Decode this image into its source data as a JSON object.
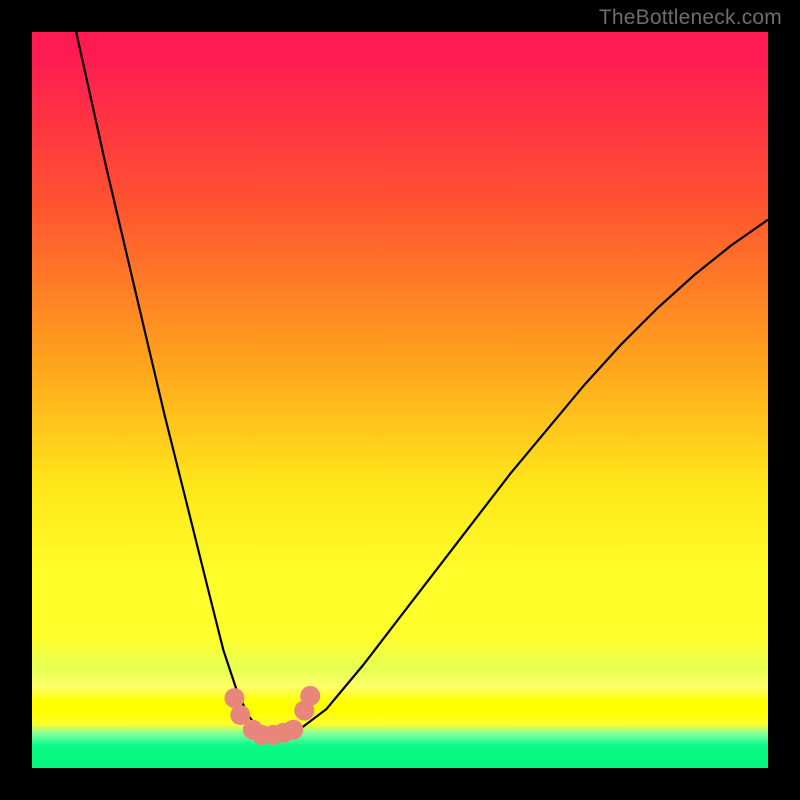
{
  "credit": "TheBottleneck.com",
  "chart_data": {
    "type": "line",
    "title": "",
    "xlabel": "",
    "ylabel": "",
    "xlim": [
      0,
      100
    ],
    "ylim": [
      0,
      100
    ],
    "series": [
      {
        "name": "bottleneck-curve",
        "x": [
          6,
          10,
          14,
          18,
          21,
          24,
          26,
          28,
          29.5,
          31,
          32.5,
          34,
          36,
          40,
          45,
          50,
          55,
          60,
          65,
          70,
          75,
          80,
          85,
          90,
          95,
          100
        ],
        "y": [
          100,
          82,
          65,
          48,
          36,
          24,
          16,
          10,
          7,
          5,
          4.5,
          4.5,
          5,
          8,
          14,
          20.5,
          27,
          33.5,
          40,
          46,
          52,
          57.5,
          62.5,
          67,
          71,
          74.5
        ]
      }
    ],
    "markers": [
      {
        "name": "left-cluster-top",
        "x": 27.5,
        "y": 9.5
      },
      {
        "name": "left-cluster-bot",
        "x": 28.3,
        "y": 7.2
      },
      {
        "name": "bottom-a",
        "x": 30.0,
        "y": 5.2
      },
      {
        "name": "bottom-b",
        "x": 31.2,
        "y": 4.5
      },
      {
        "name": "bottom-c",
        "x": 32.8,
        "y": 4.5
      },
      {
        "name": "bottom-d",
        "x": 34.2,
        "y": 4.8
      },
      {
        "name": "bottom-e",
        "x": 35.5,
        "y": 5.2
      },
      {
        "name": "right-cluster-bot",
        "x": 37.0,
        "y": 7.8
      },
      {
        "name": "right-cluster-top",
        "x": 37.8,
        "y": 9.8
      }
    ],
    "marker_color": "#e9867b",
    "marker_radius_px": 10
  }
}
